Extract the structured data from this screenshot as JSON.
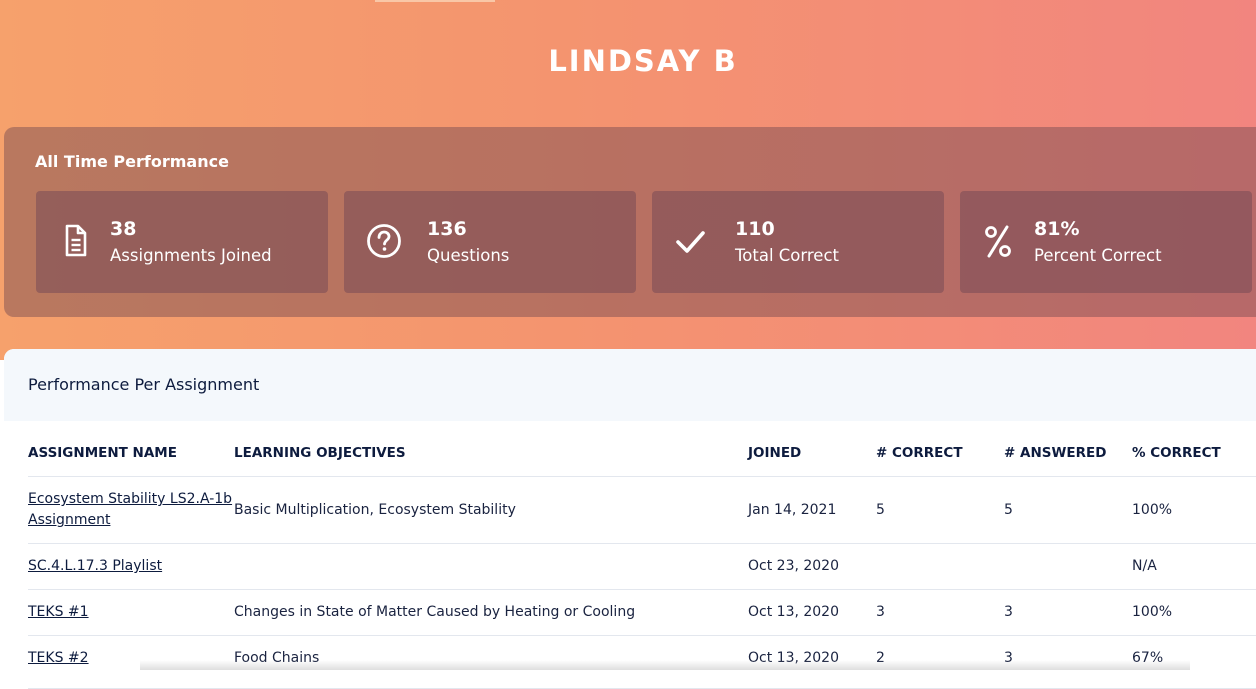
{
  "student": {
    "name": "LINDSAY B"
  },
  "all_time": {
    "title": "All Time Performance",
    "stats": [
      {
        "icon": "document-icon",
        "value": "38",
        "label": "Assignments Joined"
      },
      {
        "icon": "question-circle-icon",
        "value": "136",
        "label": "Questions"
      },
      {
        "icon": "checkmark-icon",
        "value": "110",
        "label": "Total Correct"
      },
      {
        "icon": "percent-icon",
        "value": "81%",
        "label": "Percent Correct"
      }
    ]
  },
  "per_assignment": {
    "title": "Performance Per Assignment",
    "columns": [
      "ASSIGNMENT NAME",
      "LEARNING OBJECTIVES",
      "JOINED",
      "# CORRECT",
      "# ANSWERED",
      "% CORRECT"
    ],
    "rows": [
      {
        "name": "Ecosystem Stability LS2.A-1b Assignment",
        "objectives": "Basic Multiplication, Ecosystem Stability",
        "joined": "Jan 14, 2021",
        "correct": "5",
        "answered": "5",
        "percent": "100%"
      },
      {
        "name": "SC.4.L.17.3 Playlist",
        "objectives": "",
        "joined": "Oct 23, 2020",
        "correct": "",
        "answered": "",
        "percent": "N/A"
      },
      {
        "name": "TEKS #1",
        "objectives": "Changes in State of Matter Caused by Heating or Cooling",
        "joined": "Oct 13, 2020",
        "correct": "3",
        "answered": "3",
        "percent": "100%"
      },
      {
        "name": "TEKS #2",
        "objectives": "Food Chains",
        "joined": "Oct 13, 2020",
        "correct": "2",
        "answered": "3",
        "percent": "67%"
      }
    ]
  },
  "colors": {
    "hero_start": "#f6a16c",
    "hero_end": "#f2857f",
    "text_dark": "#0d1b3e"
  }
}
